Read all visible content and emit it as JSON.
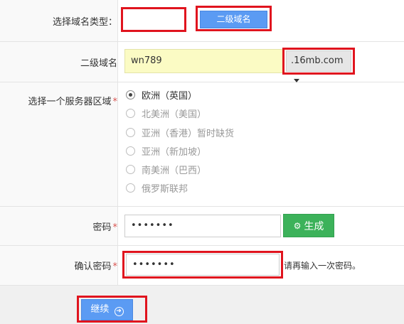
{
  "domain_type": {
    "label": "选择域名类型：",
    "selected_option": "二级域名"
  },
  "subdomain": {
    "label": "二级域名",
    "value": "wn789",
    "suffix": ".16mb.com"
  },
  "server_region": {
    "label": "选择一个服务器区域",
    "required_mark": "*",
    "options": [
      {
        "label": "欧洲（英国）",
        "selected": true,
        "disabled": false
      },
      {
        "label": "北美洲（美国）",
        "selected": false,
        "disabled": true
      },
      {
        "label": "亚洲（香港）暂时缺货",
        "selected": false,
        "disabled": true
      },
      {
        "label": "亚洲（新加坡）",
        "selected": false,
        "disabled": true
      },
      {
        "label": "南美洲（巴西）",
        "selected": false,
        "disabled": true
      },
      {
        "label": "俄罗斯联邦",
        "selected": false,
        "disabled": true
      }
    ]
  },
  "password": {
    "label": "密码",
    "required_mark": "*",
    "value": "•••••••",
    "generate_label": "生成"
  },
  "confirm_password": {
    "label": "确认密码",
    "required_mark": "*",
    "value": "•••••••",
    "hint": "请再输入一次密码。"
  },
  "submit": {
    "label": "继续"
  },
  "colors": {
    "highlight_border": "#e0141e",
    "primary_button": "#5b9bf3",
    "generate_button": "#3cb25a",
    "subdomain_input_bg": "#fbfbc4"
  }
}
